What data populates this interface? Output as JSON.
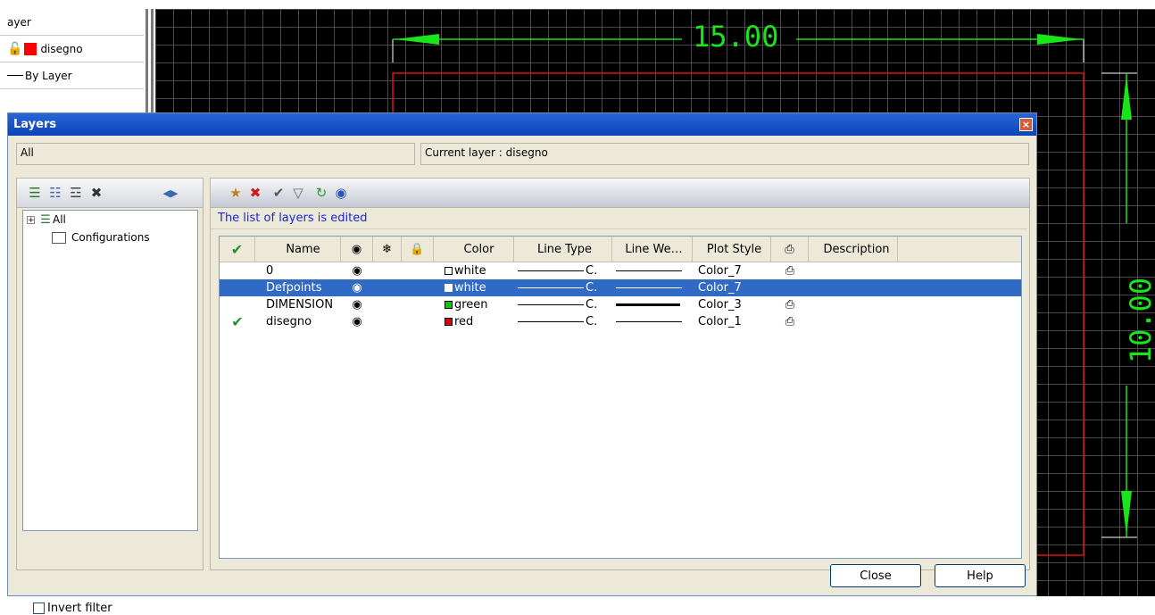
{
  "properties_panel": {
    "layer_label": "ayer",
    "current_layer": "disegno",
    "linetype": "By Layer"
  },
  "drawing": {
    "dim_horizontal": "15.00",
    "dim_vertical": "10.00"
  },
  "dialog": {
    "title": "Layers",
    "close_glyph": "×",
    "filter_name": "All",
    "current_layer_text": "Current layer : disegno",
    "tree": {
      "expand_glyph": "+",
      "items": [
        "All",
        "Configurations"
      ]
    },
    "invert_filter_label": "Invert filter",
    "status_message": "The list of layers is edited",
    "columns": [
      "Name",
      "Color",
      "Line Type",
      "Line We…",
      "Plot Style",
      "Description"
    ],
    "rows": [
      {
        "current": "",
        "name": "0",
        "color": "white",
        "color_hex": "#ffffff",
        "ltype": "C.",
        "plot": "Color_7",
        "printable": true,
        "selected": false
      },
      {
        "current": "",
        "name": "Defpoints",
        "color": "white",
        "color_hex": "#ffffff",
        "ltype": "C.",
        "plot": "Color_7",
        "printable": false,
        "selected": true
      },
      {
        "current": "",
        "name": "DIMENSION",
        "color": "green",
        "color_hex": "#00cc00",
        "ltype": "C.",
        "plot": "Color_3",
        "printable": true,
        "selected": false
      },
      {
        "current": "✔",
        "name": "disegno",
        "color": "red",
        "color_hex": "#e00000",
        "ltype": "C.",
        "plot": "Color_1",
        "printable": true,
        "selected": false
      }
    ],
    "buttons": {
      "close": "Close",
      "help": "Help"
    }
  }
}
